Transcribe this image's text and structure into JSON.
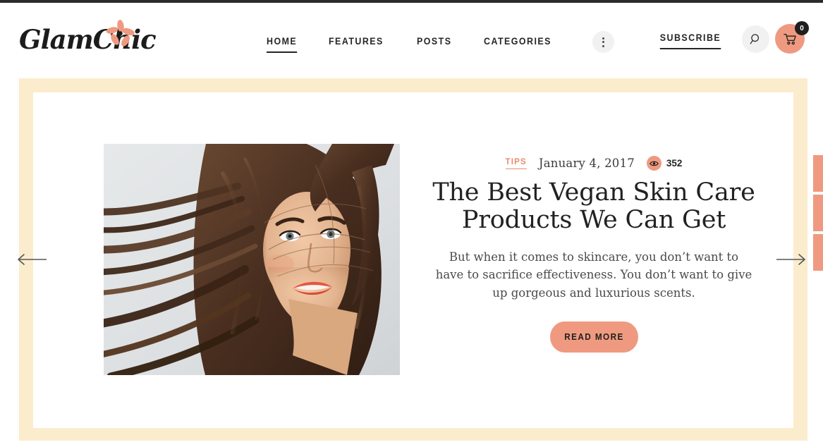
{
  "brand": {
    "name": "GlamChic",
    "flower_color": "#ef9a80"
  },
  "nav": {
    "items": [
      {
        "label": "HOME",
        "active": true
      },
      {
        "label": "FEATURES",
        "active": false
      },
      {
        "label": "POSTS",
        "active": false
      },
      {
        "label": "CATEGORIES",
        "active": false
      }
    ],
    "more_icon": "three-dots-icon"
  },
  "header_actions": {
    "subscribe_label": "SUBSCRIBE",
    "search_icon": "search-icon",
    "cart_icon": "shopping-cart-icon",
    "cart_count": "0"
  },
  "slide": {
    "category": "TIPS",
    "date": "January 4, 2017",
    "views_icon": "eye-icon",
    "views": "352",
    "title": "The Best Vegan Skin Care Products We Can Get",
    "excerpt": "But when it comes to skincare, you don’t want to have to sacrifice effectiveness. You don’t want to give up gorgeous and luxurious scents.",
    "read_more_label": "READ MORE",
    "image_alt": "smiling woman with flowing brown hair portrait"
  },
  "carousel": {
    "prev_icon": "arrow-left-icon",
    "next_icon": "arrow-right-icon"
  },
  "social_rail": {
    "items": [
      "share-facebook",
      "share-twitter",
      "share-pinterest"
    ]
  },
  "colors": {
    "accent": "#ef9a80",
    "accent_text": "#ea8a6c",
    "frame": "#fbeccd",
    "text_dark": "#262626"
  }
}
